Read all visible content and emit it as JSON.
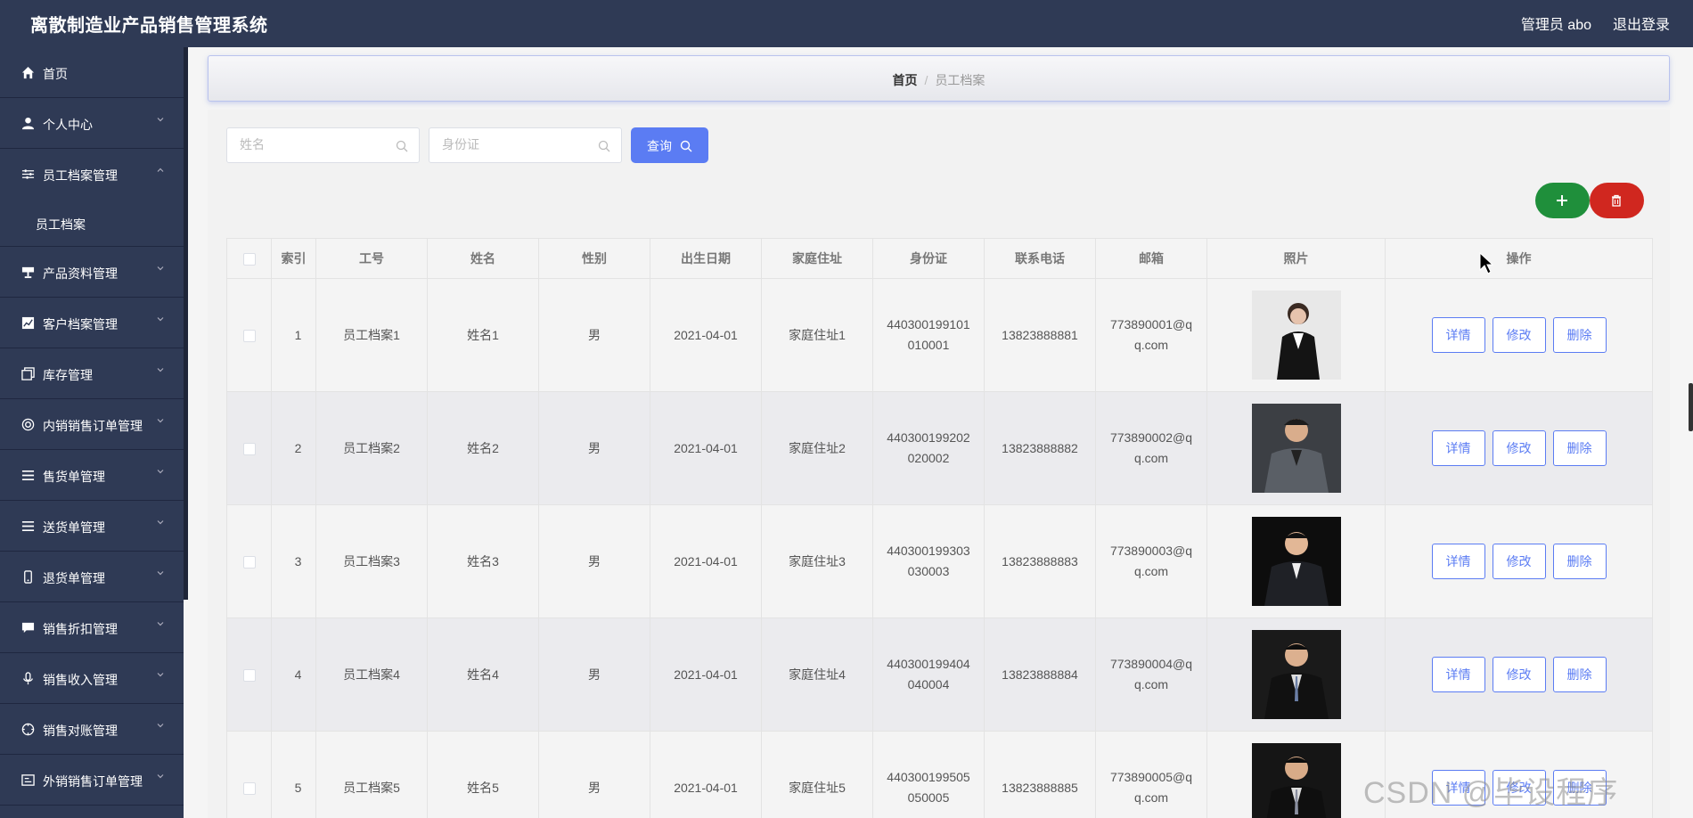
{
  "header": {
    "title": "离散制造业产品销售管理系统",
    "admin": "管理员 abo",
    "logout": "退出登录"
  },
  "sidebar": {
    "items": [
      {
        "label": "首页",
        "icon": "home-icon"
      },
      {
        "label": "个人中心",
        "icon": "user-icon"
      },
      {
        "label": "员工档案管理",
        "icon": "sliders-icon",
        "open": true
      },
      {
        "label": "产品资料管理",
        "icon": "stand-icon"
      },
      {
        "label": "客户档案管理",
        "icon": "chart-icon"
      },
      {
        "label": "库存管理",
        "icon": "copy-icon"
      },
      {
        "label": "内销销售订单管理",
        "icon": "circle-icon"
      },
      {
        "label": "售货单管理",
        "icon": "list-icon"
      },
      {
        "label": "送货单管理",
        "icon": "list-icon"
      },
      {
        "label": "退货单管理",
        "icon": "phone-icon"
      },
      {
        "label": "销售折扣管理",
        "icon": "message-icon"
      },
      {
        "label": "销售收入管理",
        "icon": "mic-icon"
      },
      {
        "label": "销售对账管理",
        "icon": "target-icon"
      },
      {
        "label": "外销销售订单管理",
        "icon": "card-icon"
      }
    ],
    "sub_item": "员工档案"
  },
  "breadcrumb": {
    "home": "首页",
    "separator": "/",
    "current": "员工档案"
  },
  "search": {
    "name_placeholder": "姓名",
    "id_placeholder": "身份证",
    "query_label": "查询"
  },
  "table": {
    "headers": [
      "索引",
      "工号",
      "姓名",
      "性别",
      "出生日期",
      "家庭住址",
      "身份证",
      "联系电话",
      "邮箱",
      "照片",
      "操作"
    ],
    "actions": {
      "detail": "详情",
      "edit": "修改",
      "delete": "删除"
    },
    "rows": [
      {
        "index": "1",
        "id": "员工档案1",
        "name": "姓名1",
        "gender": "男",
        "birth": "2021-04-01",
        "address": "家庭住址1",
        "idcard_1": "440300199101",
        "idcard_2": "010001",
        "phone": "13823888881",
        "email_1": "773890001@q",
        "email_2": "q.com"
      },
      {
        "index": "2",
        "id": "员工档案2",
        "name": "姓名2",
        "gender": "男",
        "birth": "2021-04-01",
        "address": "家庭住址2",
        "idcard_1": "440300199202",
        "idcard_2": "020002",
        "phone": "13823888882",
        "email_1": "773890002@q",
        "email_2": "q.com"
      },
      {
        "index": "3",
        "id": "员工档案3",
        "name": "姓名3",
        "gender": "男",
        "birth": "2021-04-01",
        "address": "家庭住址3",
        "idcard_1": "440300199303",
        "idcard_2": "030003",
        "phone": "13823888883",
        "email_1": "773890003@q",
        "email_2": "q.com"
      },
      {
        "index": "4",
        "id": "员工档案4",
        "name": "姓名4",
        "gender": "男",
        "birth": "2021-04-01",
        "address": "家庭住址4",
        "idcard_1": "440300199404",
        "idcard_2": "040004",
        "phone": "13823888884",
        "email_1": "773890004@q",
        "email_2": "q.com"
      },
      {
        "index": "5",
        "id": "员工档案5",
        "name": "姓名5",
        "gender": "男",
        "birth": "2021-04-01",
        "address": "家庭住址5",
        "idcard_1": "440300199505",
        "idcard_2": "050005",
        "phone": "13823888885",
        "email_1": "773890005@q",
        "email_2": "q.com"
      }
    ]
  },
  "watermark": "CSDN @毕设程序",
  "colors": {
    "nav_bg": "#2f3a55",
    "primary": "#5b7cf3",
    "add": "#1f8f3b",
    "delete": "#d0271f"
  }
}
